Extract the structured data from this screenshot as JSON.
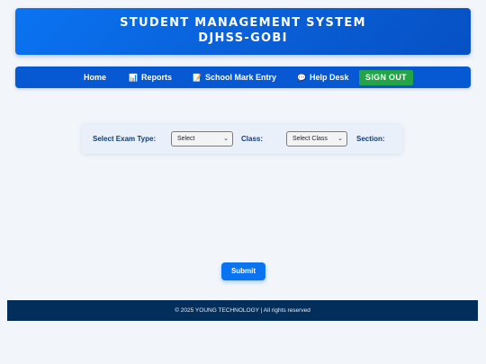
{
  "header": {
    "title": "STUDENT MANAGEMENT SYSTEM",
    "subtitle": "DJHSS-GOBI"
  },
  "nav": {
    "home": "Home",
    "reports": "Reports",
    "mark_entry": "School Mark Entry",
    "help_desk": "Help Desk",
    "sign_out": "SIGN OUT"
  },
  "filters": {
    "exam_type_label": "Select Exam Type:",
    "exam_type_value": "Select",
    "class_label": "Class:",
    "class_value": "Select Class",
    "section_label": "Section:"
  },
  "form": {
    "submit_label": "Submit"
  },
  "footer": {
    "text": "© 2025 YOUNG TECHNOLOGY | All rights reserved"
  },
  "icons": {
    "reports": "bar-chart-icon",
    "mark_entry": "memo-icon",
    "help_desk": "speech-bubble-icon"
  },
  "colors": {
    "header": "#0a6ae8",
    "nav": "#0659d2",
    "sign_out": "#22a447",
    "submit": "#0a73f0",
    "footer": "#022e5c"
  }
}
